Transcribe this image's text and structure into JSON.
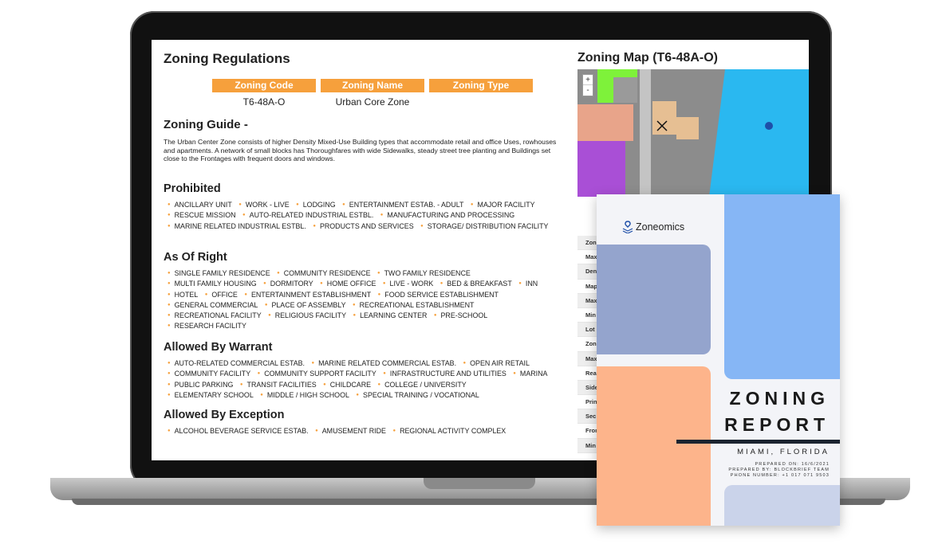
{
  "zoning": {
    "title": "Zoning Regulations",
    "code_header": "Zoning Code",
    "name_header": "Zoning Name",
    "type_header": "Zoning Type",
    "code_value": "T6-48A-O",
    "name_value": "Urban Core Zone",
    "guide_title": "Zoning Guide -",
    "guide_text": "The Urban Center Zone consists of higher Density Mixed-Use Building types that accommodate retail and office Uses, rowhouses and apartments. A network of small blocks has Thoroughfares with wide Sidewalks, steady street tree planting and Buildings set close to the Frontages with frequent doors and windows."
  },
  "categories": [
    {
      "title": "Prohibited",
      "items": [
        "ANCILLARY UNIT",
        "WORK - LIVE",
        "LODGING",
        "ENTERTAINMENT ESTAB. - ADULT",
        "MAJOR FACILITY",
        "RESCUE MISSION",
        "AUTO-RELATED INDUSTRIAL ESTBL.",
        "MANUFACTURING AND PROCESSING",
        "MARINE RELATED INDUSTRIAL ESTBL.",
        "PRODUCTS AND SERVICES",
        "STORAGE/ DISTRIBUTION FACILITY"
      ]
    },
    {
      "title": "As Of Right",
      "items": [
        "SINGLE FAMILY RESIDENCE",
        "COMMUNITY RESIDENCE",
        "TWO FAMILY RESIDENCE",
        "MULTI FAMILY HOUSING",
        "DORMITORY",
        "HOME OFFICE",
        "LIVE - WORK",
        "BED & BREAKFAST",
        "INN",
        "HOTEL",
        "OFFICE",
        "ENTERTAINMENT ESTABLISHMENT",
        "FOOD SERVICE ESTABLISHMENT",
        "GENERAL COMMERCIAL",
        "PLACE OF ASSEMBLY",
        "RECREATIONAL ESTABLISHMENT",
        "RECREATIONAL FACILITY",
        "RELIGIOUS FACILITY",
        "LEARNING CENTER",
        "PRE-SCHOOL",
        "RESEARCH FACILITY"
      ]
    },
    {
      "title": "Allowed By Warrant",
      "items": [
        "AUTO-RELATED COMMERCIAL ESTAB.",
        "MARINE RELATED COMMERCIAL ESTAB.",
        "OPEN AIR RETAIL",
        "COMMUNITY FACILITY",
        "COMMUNITY SUPPORT FACILITY",
        "INFRASTRUCTURE AND UTILITIES",
        "MARINA",
        "PUBLIC PARKING",
        "TRANSIT FACILITIES",
        "CHILDCARE",
        "COLLEGE / UNIVERSITY",
        "ELEMENTARY SCHOOL",
        "MIDDLE / HIGH SCHOOL",
        "SPECIAL TRAINING / VOCATIONAL"
      ]
    },
    {
      "title": "Allowed By Exception",
      "items": [
        "ALCOHOL BEVERAGE SERVICE ESTAB.",
        "AMUSEMENT RIDE",
        "REGIONAL ACTIVITY COMPLEX"
      ]
    }
  ],
  "map": {
    "title": "Zoning Map (T6-48A-O)",
    "zoom_in": "+",
    "zoom_out": "-"
  },
  "attributes": [
    "Zon",
    "Max",
    "Den",
    "Map",
    "Max",
    "Min",
    "Lot",
    "Zon",
    "Max",
    "Rea",
    "Side",
    "Prin",
    "Sec",
    "Fron",
    "Min"
  ],
  "report": {
    "brand": "Zoneomics",
    "title_line1": "ZONING",
    "title_line2": "REPORT",
    "city": "MIAMI, FLORIDA",
    "prepared_on": "PREPARED ON: 16/6/2021",
    "prepared_by": "PREPARED BY: BLOCKBRIEF TEAM",
    "phone": "PHONE NUMBER: +1 017 071 9503"
  },
  "colors": {
    "accent": "#f6a03c",
    "report_blue": "#86b6f5",
    "report_slate": "#94a4cd",
    "report_peach": "#fdb48b",
    "report_lavender": "#cad3ea",
    "map_cyan": "#2ab8f0"
  }
}
